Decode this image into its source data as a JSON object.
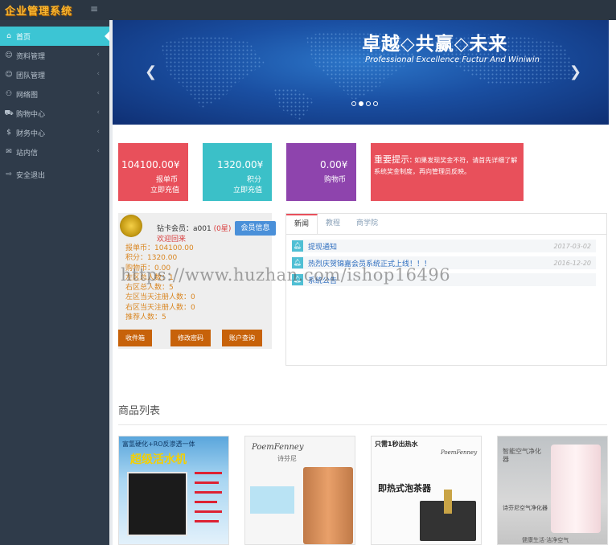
{
  "app": {
    "logo": "企业管理系统"
  },
  "sidebar": {
    "items": [
      {
        "label": "首页",
        "icon": "home-icon",
        "glyph": "⌂",
        "active": true,
        "chevron": false
      },
      {
        "label": "资料管理",
        "icon": "user-icon",
        "glyph": "☺",
        "active": false,
        "chevron": true
      },
      {
        "label": "团队管理",
        "icon": "team-icon",
        "glyph": "☺",
        "active": false,
        "chevron": true
      },
      {
        "label": "网络图",
        "icon": "sitemap-icon",
        "glyph": "⚇",
        "active": false,
        "chevron": true
      },
      {
        "label": "购物中心",
        "icon": "cart-icon",
        "glyph": "⛟",
        "active": false,
        "chevron": true
      },
      {
        "label": "财务中心",
        "icon": "dollar-icon",
        "glyph": "$",
        "active": false,
        "chevron": true
      },
      {
        "label": "站内信",
        "icon": "mail-icon",
        "glyph": "✉",
        "active": false,
        "chevron": true
      },
      {
        "label": "安全退出",
        "icon": "logout-icon",
        "glyph": "⇨",
        "active": false,
        "chevron": false
      }
    ]
  },
  "banner": {
    "title": "卓越◇共赢◇未来",
    "subtitle": "Professional Excellence Fuctur And Winiwin",
    "slides": 4,
    "current_slide": 2
  },
  "cards": {
    "bonus": {
      "value": "104100.00¥",
      "label": "报单币",
      "action": "立即充值"
    },
    "points": {
      "value": "1320.00¥",
      "label": "积分",
      "action": "立即充值"
    },
    "shopping": {
      "value": "0.00¥",
      "label": "购物币"
    },
    "notice": {
      "head": "重要提示:",
      "text": "如果发现奖金不符，请首先详细了解系统奖金制度，再向管理员反映。"
    }
  },
  "member": {
    "level_prefix": "钻卡会员：a001",
    "level_star": "(0星)",
    "welcome": "欢迎回来",
    "info_button": "会员信息",
    "lines": [
      "报单币：104100.00",
      "积分：1320.00",
      "购物币：0.00",
      "左区总人数：1",
      "右区总人数：5",
      "左区当天注册人数：0",
      "右区当天注册人数：0",
      "推荐人数：5"
    ],
    "buttons": [
      "收件箱",
      "修改密码",
      "账户查询"
    ]
  },
  "tabs": {
    "items": [
      "新闻",
      "教程",
      "商学院"
    ],
    "news": [
      {
        "title": "提现通知",
        "date": "2017-03-02"
      },
      {
        "title": "热烈庆贺锦嘉会员系统正式上线！！！",
        "date": "2016-12-20"
      },
      {
        "title": "系统公告",
        "date": ""
      }
    ]
  },
  "watermark": "https://www.huzhan.com/ishop16496",
  "products": {
    "title": "商品列表",
    "items": [
      {
        "tag": "富氢硬化+RO反渗透一体",
        "name": "超级活水机"
      },
      {
        "brand": "PoemFenney",
        "brand_cn": "诗芬尼"
      },
      {
        "tag": "只需1秒出热水",
        "brand": "PoemFenney",
        "name": "即热式泡茶器"
      },
      {
        "name": "智能空气净化器",
        "caption": "诗芬尼空气净化器",
        "slogan": "健康生活·洁净空气"
      }
    ]
  }
}
